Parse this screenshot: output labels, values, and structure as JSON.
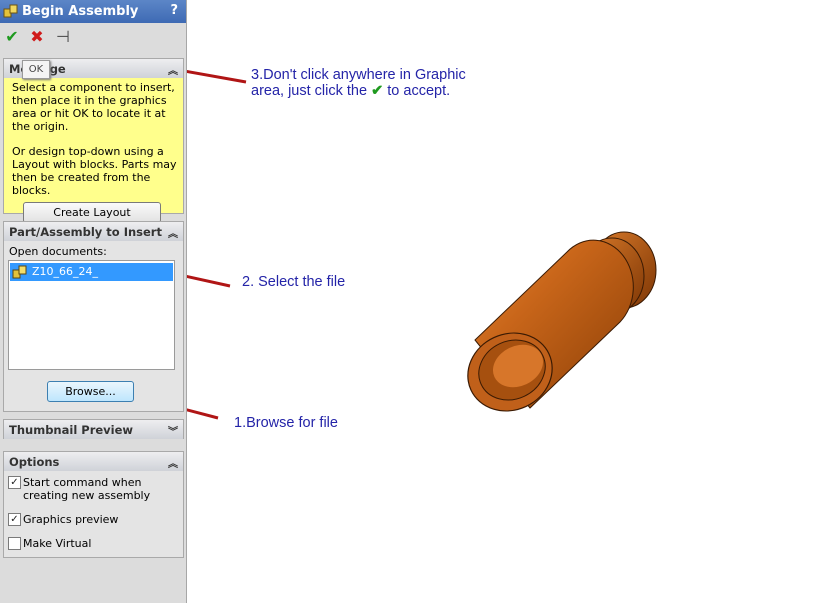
{
  "panel": {
    "title": "Begin Assembly",
    "help_glyph": "?",
    "toolbar": {
      "ok_glyph": "✔",
      "cancel_glyph": "✖",
      "pin_glyph": "⊣",
      "ok_tooltip": "OK"
    },
    "message": {
      "header": "Message",
      "text1": "Select a component to insert, then place it in the graphics area or hit OK to locate it at the origin.",
      "text2": "Or design top-down using a Layout with blocks. Parts may then be created from the blocks.",
      "create_layout_label": "Create Layout"
    },
    "insert": {
      "header": "Part/Assembly to Insert",
      "open_docs_label": "Open documents:",
      "documents": [
        "Z10_66_24_"
      ],
      "browse_label": "Browse..."
    },
    "thumbnail": {
      "header": "Thumbnail Preview"
    },
    "options": {
      "header": "Options",
      "items": [
        {
          "label": "Start command when creating new assembly",
          "checked": true
        },
        {
          "label": "Graphics preview",
          "checked": true
        },
        {
          "label": "Make Virtual",
          "checked": false
        }
      ]
    }
  },
  "annotations": {
    "step3_line1": "3.Don't click anywhere in Graphic",
    "step3_line2a": "area, just click the",
    "step3_line2b": "to accept.",
    "step2": "2. Select the file",
    "step1": "1.Browse for file"
  },
  "colors": {
    "accent_title": "#4a75bd",
    "message_bg": "#ffff8c",
    "selection": "#3399ff",
    "annotation_text": "#2424a8",
    "arrow": "#b01515",
    "part": "#b8540e"
  }
}
